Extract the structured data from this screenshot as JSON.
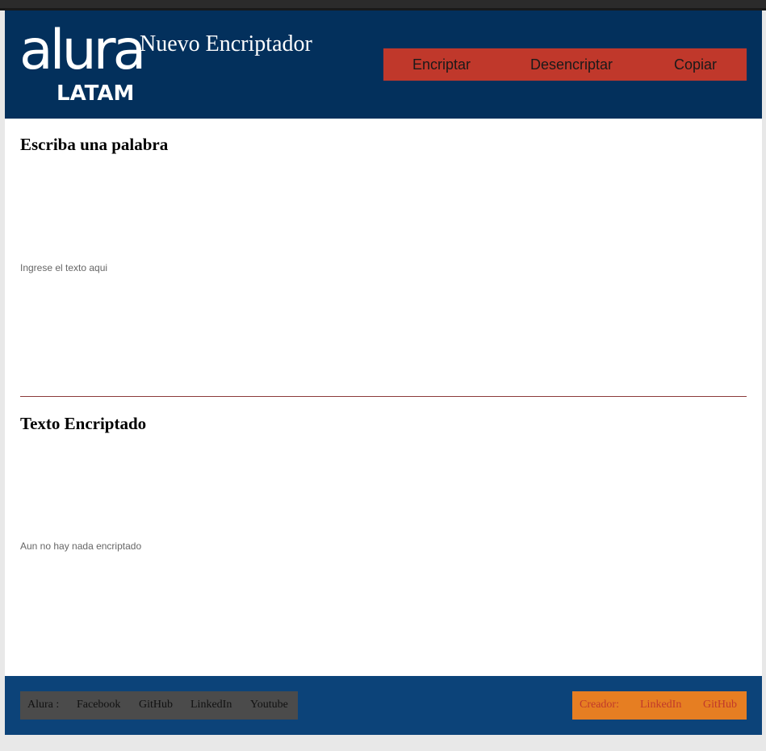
{
  "header": {
    "logo_main": "alura",
    "logo_sub": "LATAM",
    "title": "Nuevo Encriptador",
    "nav": [
      {
        "label": "Encriptar"
      },
      {
        "label": "Desencriptar"
      },
      {
        "label": "Copiar"
      }
    ]
  },
  "input_section": {
    "title": "Escriba una palabra",
    "placeholder": "Ingrese el texto aqui",
    "value": ""
  },
  "output_section": {
    "title": "Texto Encriptado",
    "message": "Aun no hay nada encriptado"
  },
  "footer": {
    "left": {
      "label": "Alura :",
      "links": [
        "Facebook",
        "GitHub",
        "LinkedIn",
        "Youtube"
      ]
    },
    "right": {
      "label": "Creador:",
      "links": [
        "LinkedIn",
        "GitHub"
      ]
    }
  },
  "colors": {
    "header_bg": "#03305c",
    "nav_bg": "#c0382b",
    "footer_bg": "#0c4379",
    "footer_left_bg": "#4b4b4b",
    "footer_right_bg": "#e67e22",
    "divider": "#8b3a3a"
  }
}
